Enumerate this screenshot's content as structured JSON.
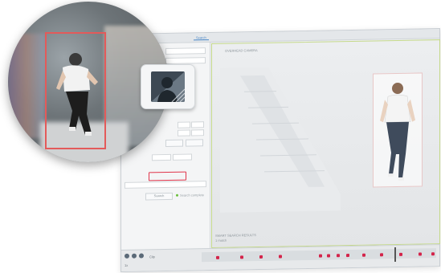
{
  "window": {
    "tabs": [
      "Search"
    ],
    "active_tab_index": 0
  },
  "video": {
    "top_label": "OVERHEAD CAMERA",
    "bottom_label": "SMART SEARCH RESULTS",
    "bottom_sublabel": "1 match"
  },
  "left_panel": {
    "search_button": "Search",
    "status_label": "Search complete"
  },
  "timeline": {
    "clip_label": "Clip",
    "speed_label": "1x"
  },
  "colors": {
    "selection": "#e0344a",
    "timeline_marker": "#d3244a",
    "active_tab": "#4a87c7",
    "status_ok": "#6bbf3c"
  },
  "icons": {
    "tile": "person-silhouette-icon"
  }
}
